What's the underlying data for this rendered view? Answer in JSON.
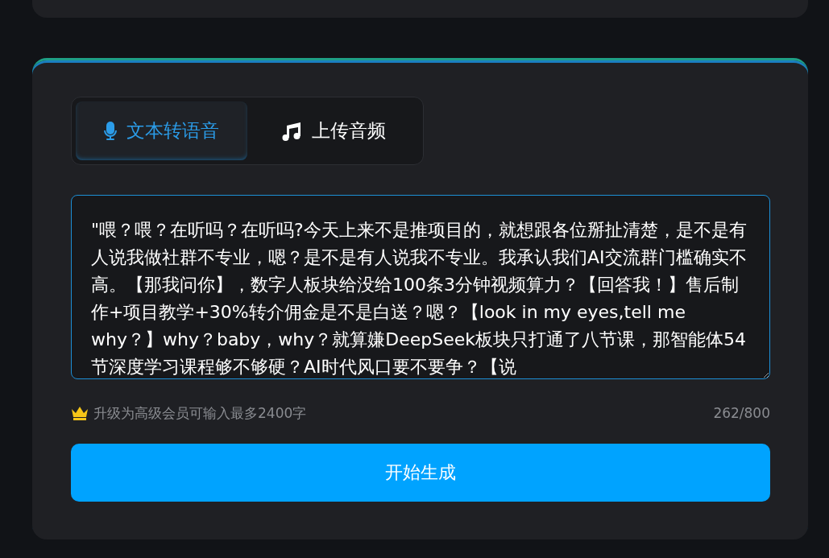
{
  "tabs": [
    {
      "label": "文本转语音",
      "selected": true
    },
    {
      "label": "上传音频",
      "selected": false
    }
  ],
  "text_input": {
    "value": "\"喂？喂？在听吗？在听吗?今天上来不是推项目的，就想跟各位掰扯清楚，是不是有人说我做社群不专业，嗯？是不是有人说我不专业。我承认我们AI交流群门槛确实不高。【那我问你】，数字人板块给没给100条3分钟视频算力？【回答我！】售后制作+项目教学+30%转介佣金是不是白送？嗯？【look in my eyes,tell me why？】why？baby，why？就算嫌DeepSeek板块只打通了八节课，那智能体54节深度学习课程够不够硬？AI时代风口要不要争？【说"
  },
  "upgrade_hint": "升级为高级会员可输入最多2400字",
  "char_count": "262/800",
  "generate_button": "开始生成"
}
